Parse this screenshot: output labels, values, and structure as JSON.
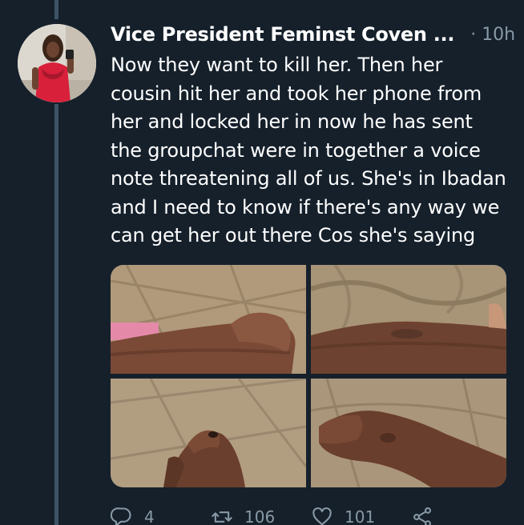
{
  "tweet": {
    "display_name": "Vice President Feminst Coven ...",
    "separator": "·",
    "timestamp": "10h",
    "text": "Now  they want to kill her. Then her\ncousin hit her and took her phone from\nher and locked her in now he has sent\nthe groupchat were in together a voice\nnote threatening all of us. She's in Ibadan\nand I need to know if there's any way we\ncan get her out there Cos she's saying",
    "menu_icon": "chevron-down-icon"
  },
  "media": {
    "count": 4,
    "photos": [
      {
        "description_icon": "photo"
      },
      {
        "description_icon": "photo"
      },
      {
        "description_icon": "photo"
      },
      {
        "description_icon": "photo"
      }
    ]
  },
  "actions": {
    "reply": {
      "icon": "reply-icon",
      "count": "4"
    },
    "retweet": {
      "icon": "retweet-icon",
      "count": "106"
    },
    "like": {
      "icon": "heart-icon",
      "count": "101"
    },
    "share": {
      "icon": "share-icon"
    }
  },
  "colors": {
    "background": "#15202b",
    "thread_line": "#3d5466",
    "secondary_text": "#8899a6",
    "primary_text": "#ffffff"
  }
}
